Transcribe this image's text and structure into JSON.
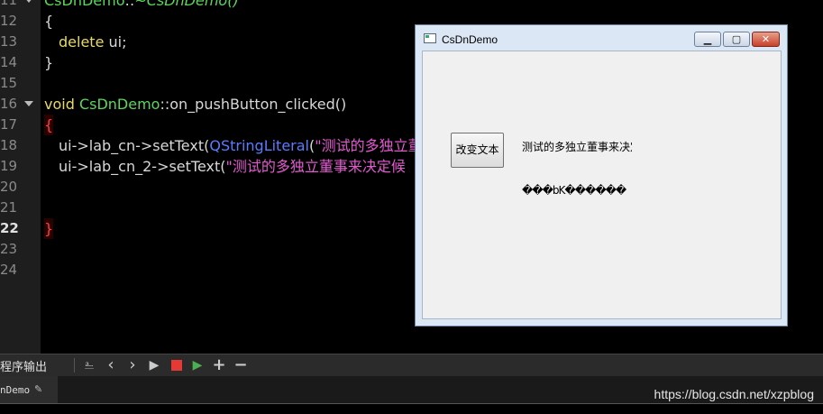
{
  "editor": {
    "lines": [
      {
        "num": "11",
        "text": ""
      },
      {
        "num": "12",
        "text": "{"
      },
      {
        "num": "13",
        "text": ""
      },
      {
        "num": "14",
        "text": "}"
      },
      {
        "num": "15",
        "text": ""
      },
      {
        "num": "16",
        "text": ""
      },
      {
        "num": "17",
        "text": "{"
      },
      {
        "num": "18",
        "text": ""
      },
      {
        "num": "19",
        "text": ""
      },
      {
        "num": "20",
        "text": ""
      },
      {
        "num": "21",
        "text": ""
      },
      {
        "num": "22",
        "text": "}"
      },
      {
        "num": "23",
        "text": ""
      },
      {
        "num": "24",
        "text": ""
      }
    ],
    "l11": {
      "cls": "CsDnDemo",
      "sep": "::",
      "fn": "~CsDnDemo()"
    },
    "l13": {
      "kw": "delete",
      "rest": " ui;"
    },
    "l16": {
      "kw": "void",
      "cls": "CsDnDemo",
      "rest": "::on_pushButton_clicked()"
    },
    "l18": {
      "pre": "ui->lab_cn->setText(",
      "qt": "QStringLiteral",
      "paren": "(",
      "str": "\"测试的多独立董"
    },
    "l19": {
      "pre": "ui->lab_cn_2->setText(",
      "str": "\"测试的多独立董事来决定候"
    }
  },
  "window": {
    "title": "CsDnDemo",
    "min_glyph": "▁",
    "max_glyph": "▢",
    "close_glyph": "✕",
    "button_label": "改变文本",
    "label_cn": "测试的多独立董事来决定",
    "label_cn_2": "���bK������"
  },
  "output": {
    "title": "程序输出",
    "tab_label": "nDemo",
    "pin_icon": "✎",
    "toolbar": {
      "clear": "⎁",
      "prev": "‹",
      "next": "›",
      "run": "▶",
      "plus": "+",
      "minus": "−"
    }
  },
  "watermark": "https://blog.csdn.net/xzpblog",
  "colors": {
    "keyword": "#e8d96a",
    "class": "#5cd65c",
    "string": "#e35ad0",
    "qstring": "#5a7cff",
    "brace_match": "#ff4040"
  }
}
